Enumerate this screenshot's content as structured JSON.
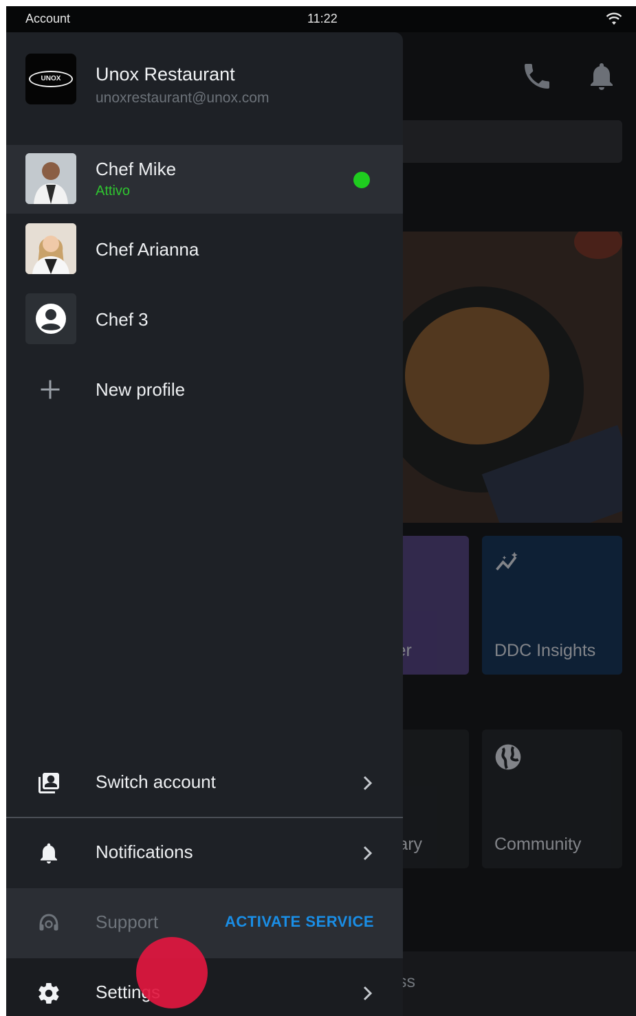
{
  "status_bar": {
    "left_label": "Account",
    "time": "11:22",
    "wifi_icon": "wifi-icon"
  },
  "account": {
    "name": "Unox Restaurant",
    "email": "unoxrestaurant@unox.com",
    "logo_text": "UNOX"
  },
  "profiles": [
    {
      "name": "Chef Mike",
      "status": "Attivo",
      "active": true
    },
    {
      "name": "Chef Arianna"
    },
    {
      "name": "Chef 3"
    }
  ],
  "new_profile_label": "New profile",
  "menu": {
    "switch_account": "Switch account",
    "notifications": "Notifications",
    "support": "Support",
    "activate_service": "ACTIVATE SERVICE",
    "settings": "Settings"
  },
  "background": {
    "tile_partial_1": "ler",
    "tile_ddc": "DDC Insights",
    "tile_partial_2": "rary",
    "tile_community": "Community",
    "bottom_partial": "ss"
  },
  "colors": {
    "drawer_bg": "#1e2126",
    "active_row": "#2b2e34",
    "online": "#1fcc1f",
    "status_text": "#2fc52f",
    "activate": "#1a8ee6",
    "touch_indicator": "#e1173f"
  }
}
